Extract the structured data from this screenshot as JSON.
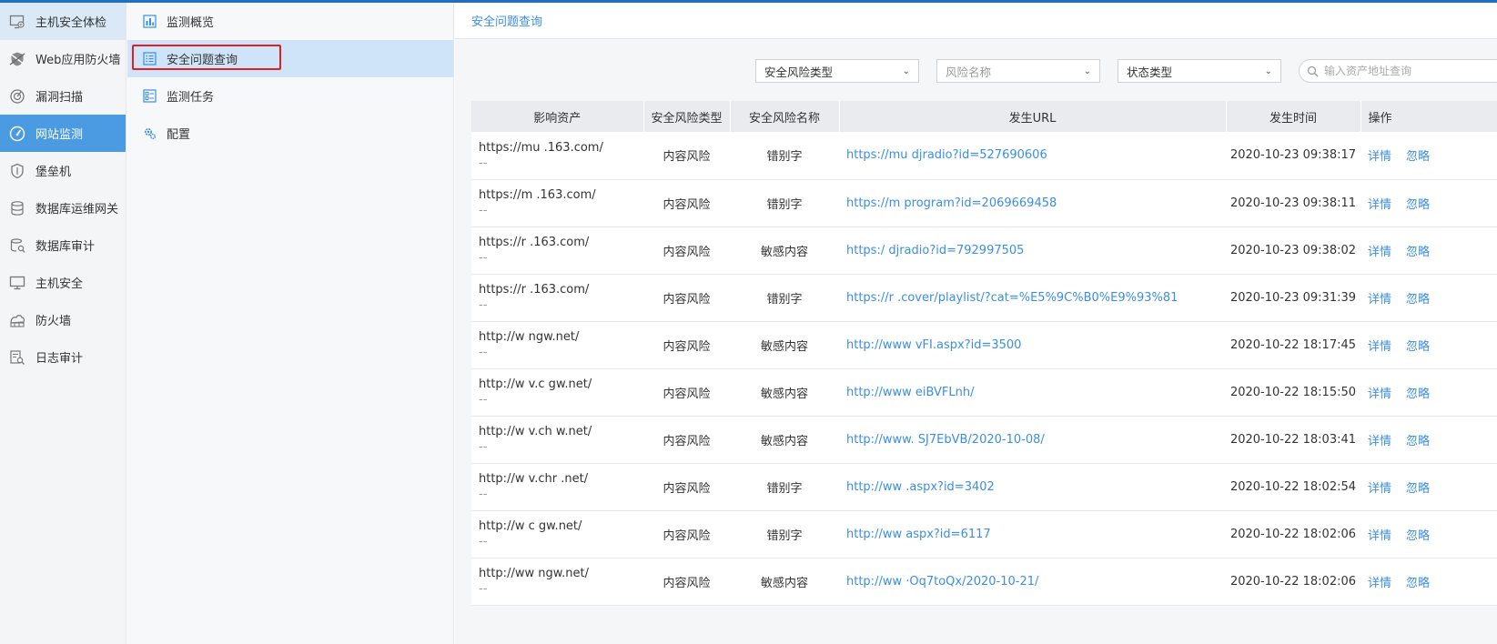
{
  "sidebar": {
    "items": [
      {
        "label": "主机安全体检",
        "icon": "host-check-icon"
      },
      {
        "label": "Web应用防火墙",
        "icon": "waf-shield-icon"
      },
      {
        "label": "漏洞扫描",
        "icon": "scan-icon"
      },
      {
        "label": "网站监测",
        "icon": "gauge-icon"
      },
      {
        "label": "堡垒机",
        "icon": "bastion-shield-icon"
      },
      {
        "label": "数据库运维网关",
        "icon": "database-icon"
      },
      {
        "label": "数据库审计",
        "icon": "database-search-icon"
      },
      {
        "label": "主机安全",
        "icon": "monitor-icon"
      },
      {
        "label": "防火墙",
        "icon": "firewall-icon"
      },
      {
        "label": "日志审计",
        "icon": "log-audit-icon"
      }
    ]
  },
  "submenu": {
    "items": [
      {
        "label": "监测概览",
        "icon": "chart-icon"
      },
      {
        "label": "安全问题查询",
        "icon": "list-icon"
      },
      {
        "label": "监测任务",
        "icon": "task-icon"
      },
      {
        "label": "配置",
        "icon": "config-icon"
      }
    ]
  },
  "breadcrumb": {
    "title": "安全问题查询"
  },
  "filters": {
    "risk_type": "安全风险类型",
    "risk_name": "风险名称",
    "status_type": "状态类型",
    "search_placeholder": "输入资产地址查询"
  },
  "table": {
    "headers": [
      "影响资产",
      "安全风险类型",
      "安全风险名称",
      "发生URL",
      "发生时间",
      "操作"
    ],
    "rows": [
      {
        "asset": "https://mu    .163.com/",
        "asset_sub": "--",
        "type": "内容风险",
        "name": "错别字",
        "url": "https://mu                    djradio?id=527690606",
        "time": "2020-10-23 09:38:17",
        "detail": "详情",
        "ignore": "忽略"
      },
      {
        "asset": "https://m     .163.com/",
        "asset_sub": "--",
        "type": "内容风险",
        "name": "错别字",
        "url": "https://m                     program?id=2069669458",
        "time": "2020-10-23 09:38:11",
        "detail": "详情",
        "ignore": "忽略"
      },
      {
        "asset": "https://r     .163.com/",
        "asset_sub": "--",
        "type": "内容风险",
        "name": "敏感内容",
        "url": "https:/                      djradio?id=792997505",
        "time": "2020-10-23 09:38:02",
        "detail": "详情",
        "ignore": "忽略"
      },
      {
        "asset": "https://r     .163.com/",
        "asset_sub": "--",
        "type": "内容风险",
        "name": "错别字",
        "url": "https://r                    .cover/playlist/?cat=%E5%9C%B0%E9%93%81",
        "time": "2020-10-23 09:31:39",
        "detail": "详情",
        "ignore": "忽略"
      },
      {
        "asset": "http://w     ngw.net/",
        "asset_sub": "--",
        "type": "内容风险",
        "name": "敏感内容",
        "url": "http://www                 vFI.aspx?id=3500",
        "time": "2020-10-22 18:17:45",
        "detail": "详情",
        "ignore": "忽略"
      },
      {
        "asset": "http://w   v.c   gw.net/",
        "asset_sub": "--",
        "type": "内容风险",
        "name": "敏感内容",
        "url": "http://www                 eiBVFLnh/",
        "time": "2020-10-22 18:15:50",
        "detail": "详情",
        "ignore": "忽略"
      },
      {
        "asset": "http://w   v.ch    w.net/",
        "asset_sub": "--",
        "type": "内容风险",
        "name": "敏感内容",
        "url": "http://www.               SJ7EbVB/2020-10-08/",
        "time": "2020-10-22 18:03:41",
        "detail": "详情",
        "ignore": "忽略"
      },
      {
        "asset": "http://w   v.chr    .net/",
        "asset_sub": "--",
        "type": "内容风险",
        "name": "错别字",
        "url": "http://ww                  .aspx?id=3402",
        "time": "2020-10-22 18:02:54",
        "detail": "详情",
        "ignore": "忽略"
      },
      {
        "asset": "http://w     c   gw.net/",
        "asset_sub": "--",
        "type": "内容风险",
        "name": "错别字",
        "url": "http://ww                  aspx?id=6117",
        "time": "2020-10-22 18:02:06",
        "detail": "详情",
        "ignore": "忽略"
      },
      {
        "asset": "http://ww     ngw.net/",
        "asset_sub": "--",
        "type": "内容风险",
        "name": "敏感内容",
        "url": "http://ww                  ·Oq7toQx/2020-10-21/",
        "time": "2020-10-22 18:02:06",
        "detail": "详情",
        "ignore": "忽略"
      }
    ]
  },
  "colors": {
    "accent": "#4a9be2",
    "link": "#3a8ee6",
    "highlight_border": "#e02020"
  }
}
